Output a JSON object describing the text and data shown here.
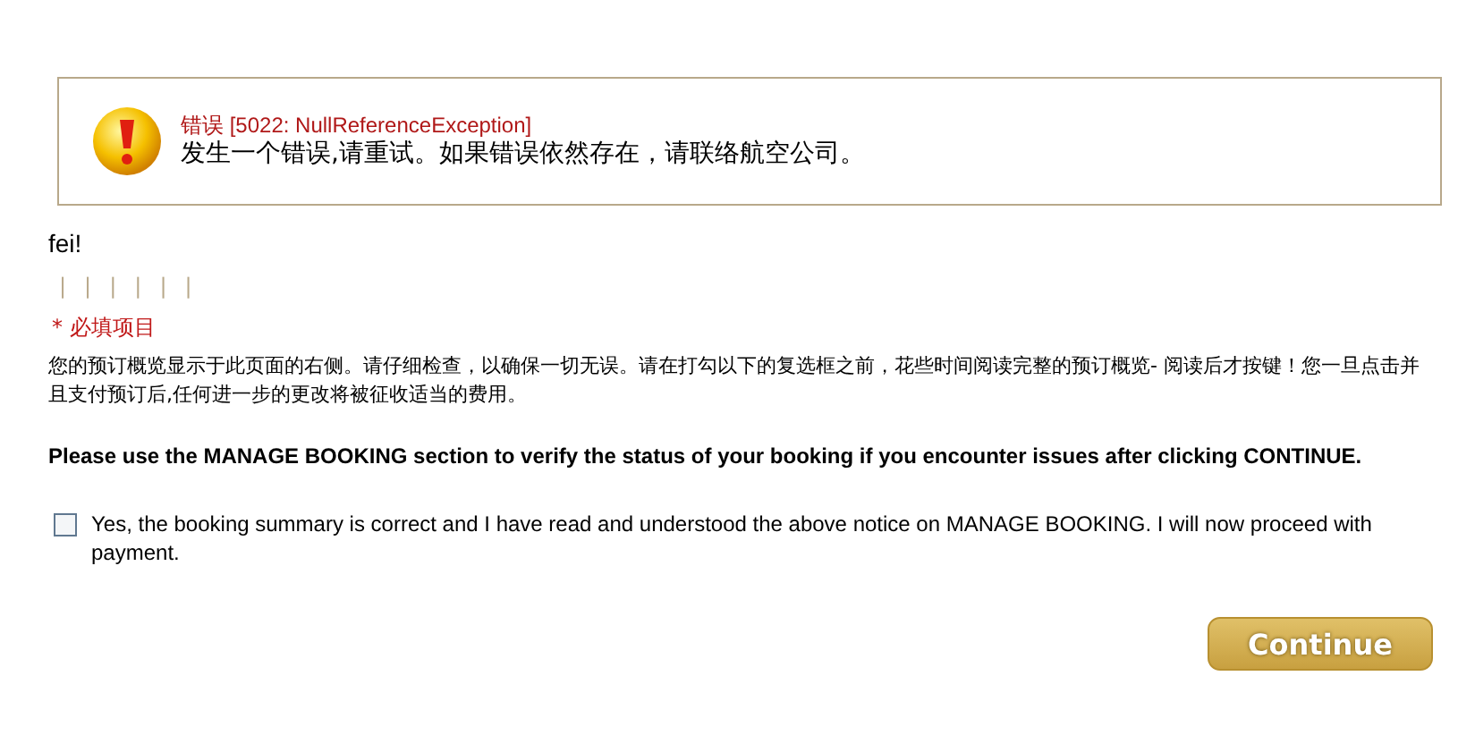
{
  "error": {
    "title": "错误",
    "code": "[5022: NullReferenceException]",
    "message": "发生一个错误,请重试。如果错误依然存在，请联络航空公司。"
  },
  "greeting": "fei!",
  "separators": [
    "|",
    "|",
    "|",
    "|",
    "|",
    "|"
  ],
  "required_note": "* 必填项目",
  "notice": "您的预订概览显示于此页面的右侧。请仔细检查，以确保一切无误。请在打勾以下的复选框之前，花些时间阅读完整的预订概览- 阅读后才按键！您一旦点击并且支付预订后,任何进一步的更改将被征收适当的费用。",
  "warning": "Please use the MANAGE BOOKING section to verify the status of your booking if you encounter issues after clicking CONTINUE.",
  "confirm": {
    "checked": false,
    "label": "Yes, the booking summary is correct and I have read and understood the above notice on MANAGE BOOKING. I will now proceed with payment."
  },
  "continue_button": "Continue"
}
